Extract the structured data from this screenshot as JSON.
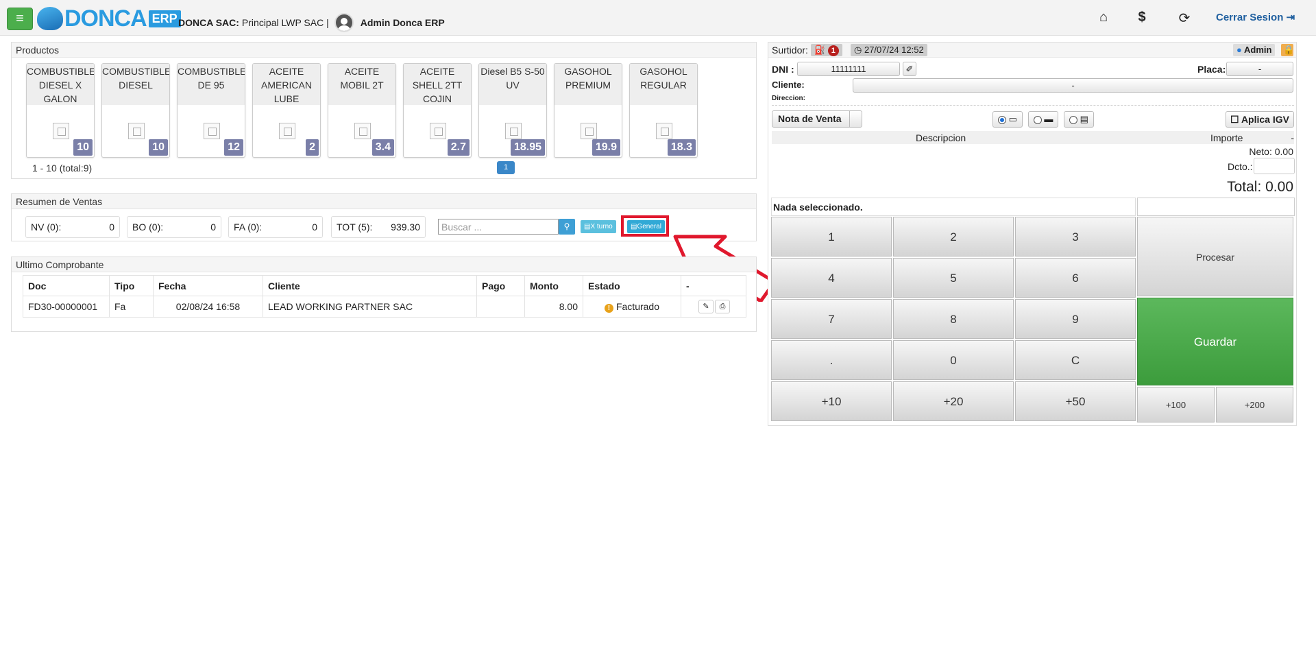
{
  "header": {
    "logo_main": "DONCA",
    "logo_suffix": "ERP",
    "company_name": "DONCA SAC:",
    "branch": "Principal LWP SAC |",
    "user": "Admin Donca ERP",
    "logout": "Cerrar Sesion"
  },
  "products": {
    "title": "Productos",
    "items": [
      {
        "name": "COMBUSTIBLE DIESEL X GALON",
        "price": "10"
      },
      {
        "name": "COMBUSTIBLE DIESEL",
        "price": "10"
      },
      {
        "name": "COMBUSTIBLE DE 95",
        "price": "12"
      },
      {
        "name": "ACEITE AMERICAN LUBE",
        "price": "2"
      },
      {
        "name": "ACEITE MOBIL 2T",
        "price": "3.4"
      },
      {
        "name": "ACEITE SHELL 2TT COJIN",
        "price": "2.7"
      },
      {
        "name": "Diesel B5 S-50 UV",
        "price": "18.95"
      },
      {
        "name": "GASOHOL PREMIUM",
        "price": "19.9"
      },
      {
        "name": "GASOHOL REGULAR",
        "price": "18.3"
      }
    ],
    "pager_info": "1 - 10 (total:9)",
    "page": "1"
  },
  "summary": {
    "title": "Resumen de Ventas",
    "boxes": [
      {
        "label": "NV (0):",
        "value": "0"
      },
      {
        "label": "BO (0):",
        "value": "0"
      },
      {
        "label": "FA (0):",
        "value": "0"
      },
      {
        "label": "TOT (5):",
        "value": "939.30"
      }
    ],
    "search_placeholder": "Buscar ...",
    "x_turno": "X turno",
    "general": "General"
  },
  "ultimo": {
    "title": "Ultimo Comprobante",
    "columns": [
      "Doc",
      "Tipo",
      "Fecha",
      "Cliente",
      "Pago",
      "Monto",
      "Estado",
      "-"
    ],
    "rows": [
      {
        "doc": "FD30-00000001",
        "tipo": "Fa",
        "fecha": "02/08/24 16:58",
        "cliente": "LEAD WORKING PARTNER SAC",
        "pago": "",
        "monto": "8.00",
        "estado": "Facturado"
      }
    ]
  },
  "pos": {
    "surtidor_label": "Surtidor:",
    "surtidor_count": "1",
    "datetime": "27/07/24 12:52",
    "admin": "Admin",
    "dni_label": "DNI :",
    "dni_value": "11111111",
    "placa_label": "Placa:",
    "placa_value": "-",
    "cliente_label": "Cliente:",
    "cliente_value": "-",
    "direccion_label": "Direccion:",
    "doc_type": "Nota de Venta",
    "aplica_igv": "Aplica IGV",
    "col_desc": "Descripcion",
    "col_importe": "Importe",
    "col_dash": "-",
    "neto": "Neto: 0.00",
    "dcto": "Dcto.:",
    "total": "Total: 0.00",
    "nada": "Nada seleccionado.",
    "keys": [
      "1",
      "2",
      "3",
      "4",
      "5",
      "6",
      "7",
      "8",
      "9",
      ".",
      "0",
      "C"
    ],
    "quick": [
      "+10",
      "+20",
      "+50",
      "+100",
      "+200"
    ],
    "procesar": "Procesar",
    "guardar": "Guardar"
  }
}
